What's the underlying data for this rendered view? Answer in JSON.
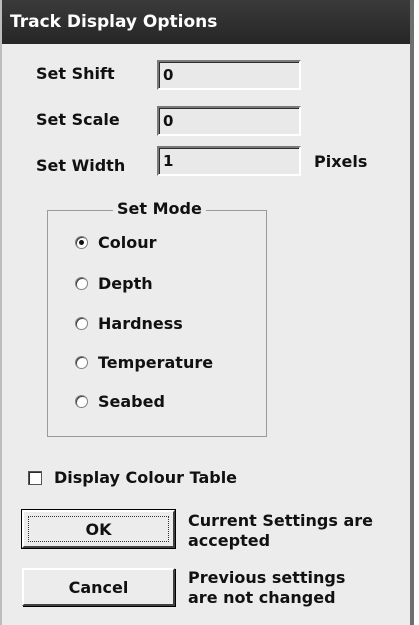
{
  "window": {
    "title": "Track Display Options"
  },
  "fields": {
    "shift": {
      "label": "Set Shift",
      "value": "0"
    },
    "scale": {
      "label": "Set Scale",
      "value": "0"
    },
    "width": {
      "label": "Set Width",
      "value": "1",
      "unit": "Pixels"
    }
  },
  "mode": {
    "title": "Set Mode",
    "options": [
      "Colour",
      "Depth",
      "Hardness",
      "Temperature",
      "Seabed"
    ],
    "selected": "Colour"
  },
  "display_colour_table": {
    "label": "Display Colour Table",
    "checked": false
  },
  "buttons": {
    "ok": {
      "label": "OK",
      "note_line1": "Current Settings are",
      "note_line2": "accepted"
    },
    "cancel": {
      "label": "Cancel",
      "note_line1": "Previous settings",
      "note_line2": "are not changed"
    }
  }
}
